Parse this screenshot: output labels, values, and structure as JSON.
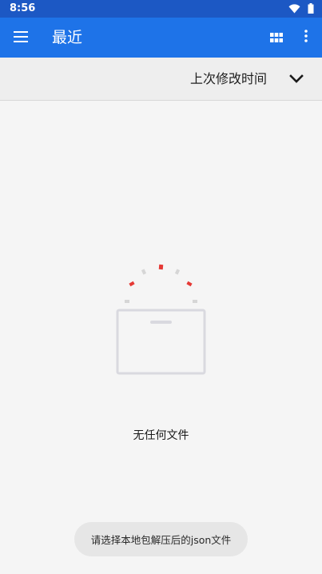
{
  "status_bar": {
    "time": "8:56",
    "icons": [
      "wifi-icon",
      "battery-icon"
    ]
  },
  "app_bar": {
    "title": "最近",
    "icons": [
      "menu-icon",
      "grid-view-icon",
      "more-vert-icon"
    ]
  },
  "sort_bar": {
    "label": "上次修改时间",
    "icon": "chevron-down-icon"
  },
  "empty_state": {
    "message": "无任何文件",
    "icon": "empty-box-icon"
  },
  "toast": {
    "message": "请选择本地包解压后的json文件"
  },
  "colors": {
    "status_bar": "#1c58c4",
    "app_bar": "#1e73e8",
    "background": "#f5f5f5",
    "sort_bar": "#eeeeee",
    "accent_red": "#e53935"
  }
}
